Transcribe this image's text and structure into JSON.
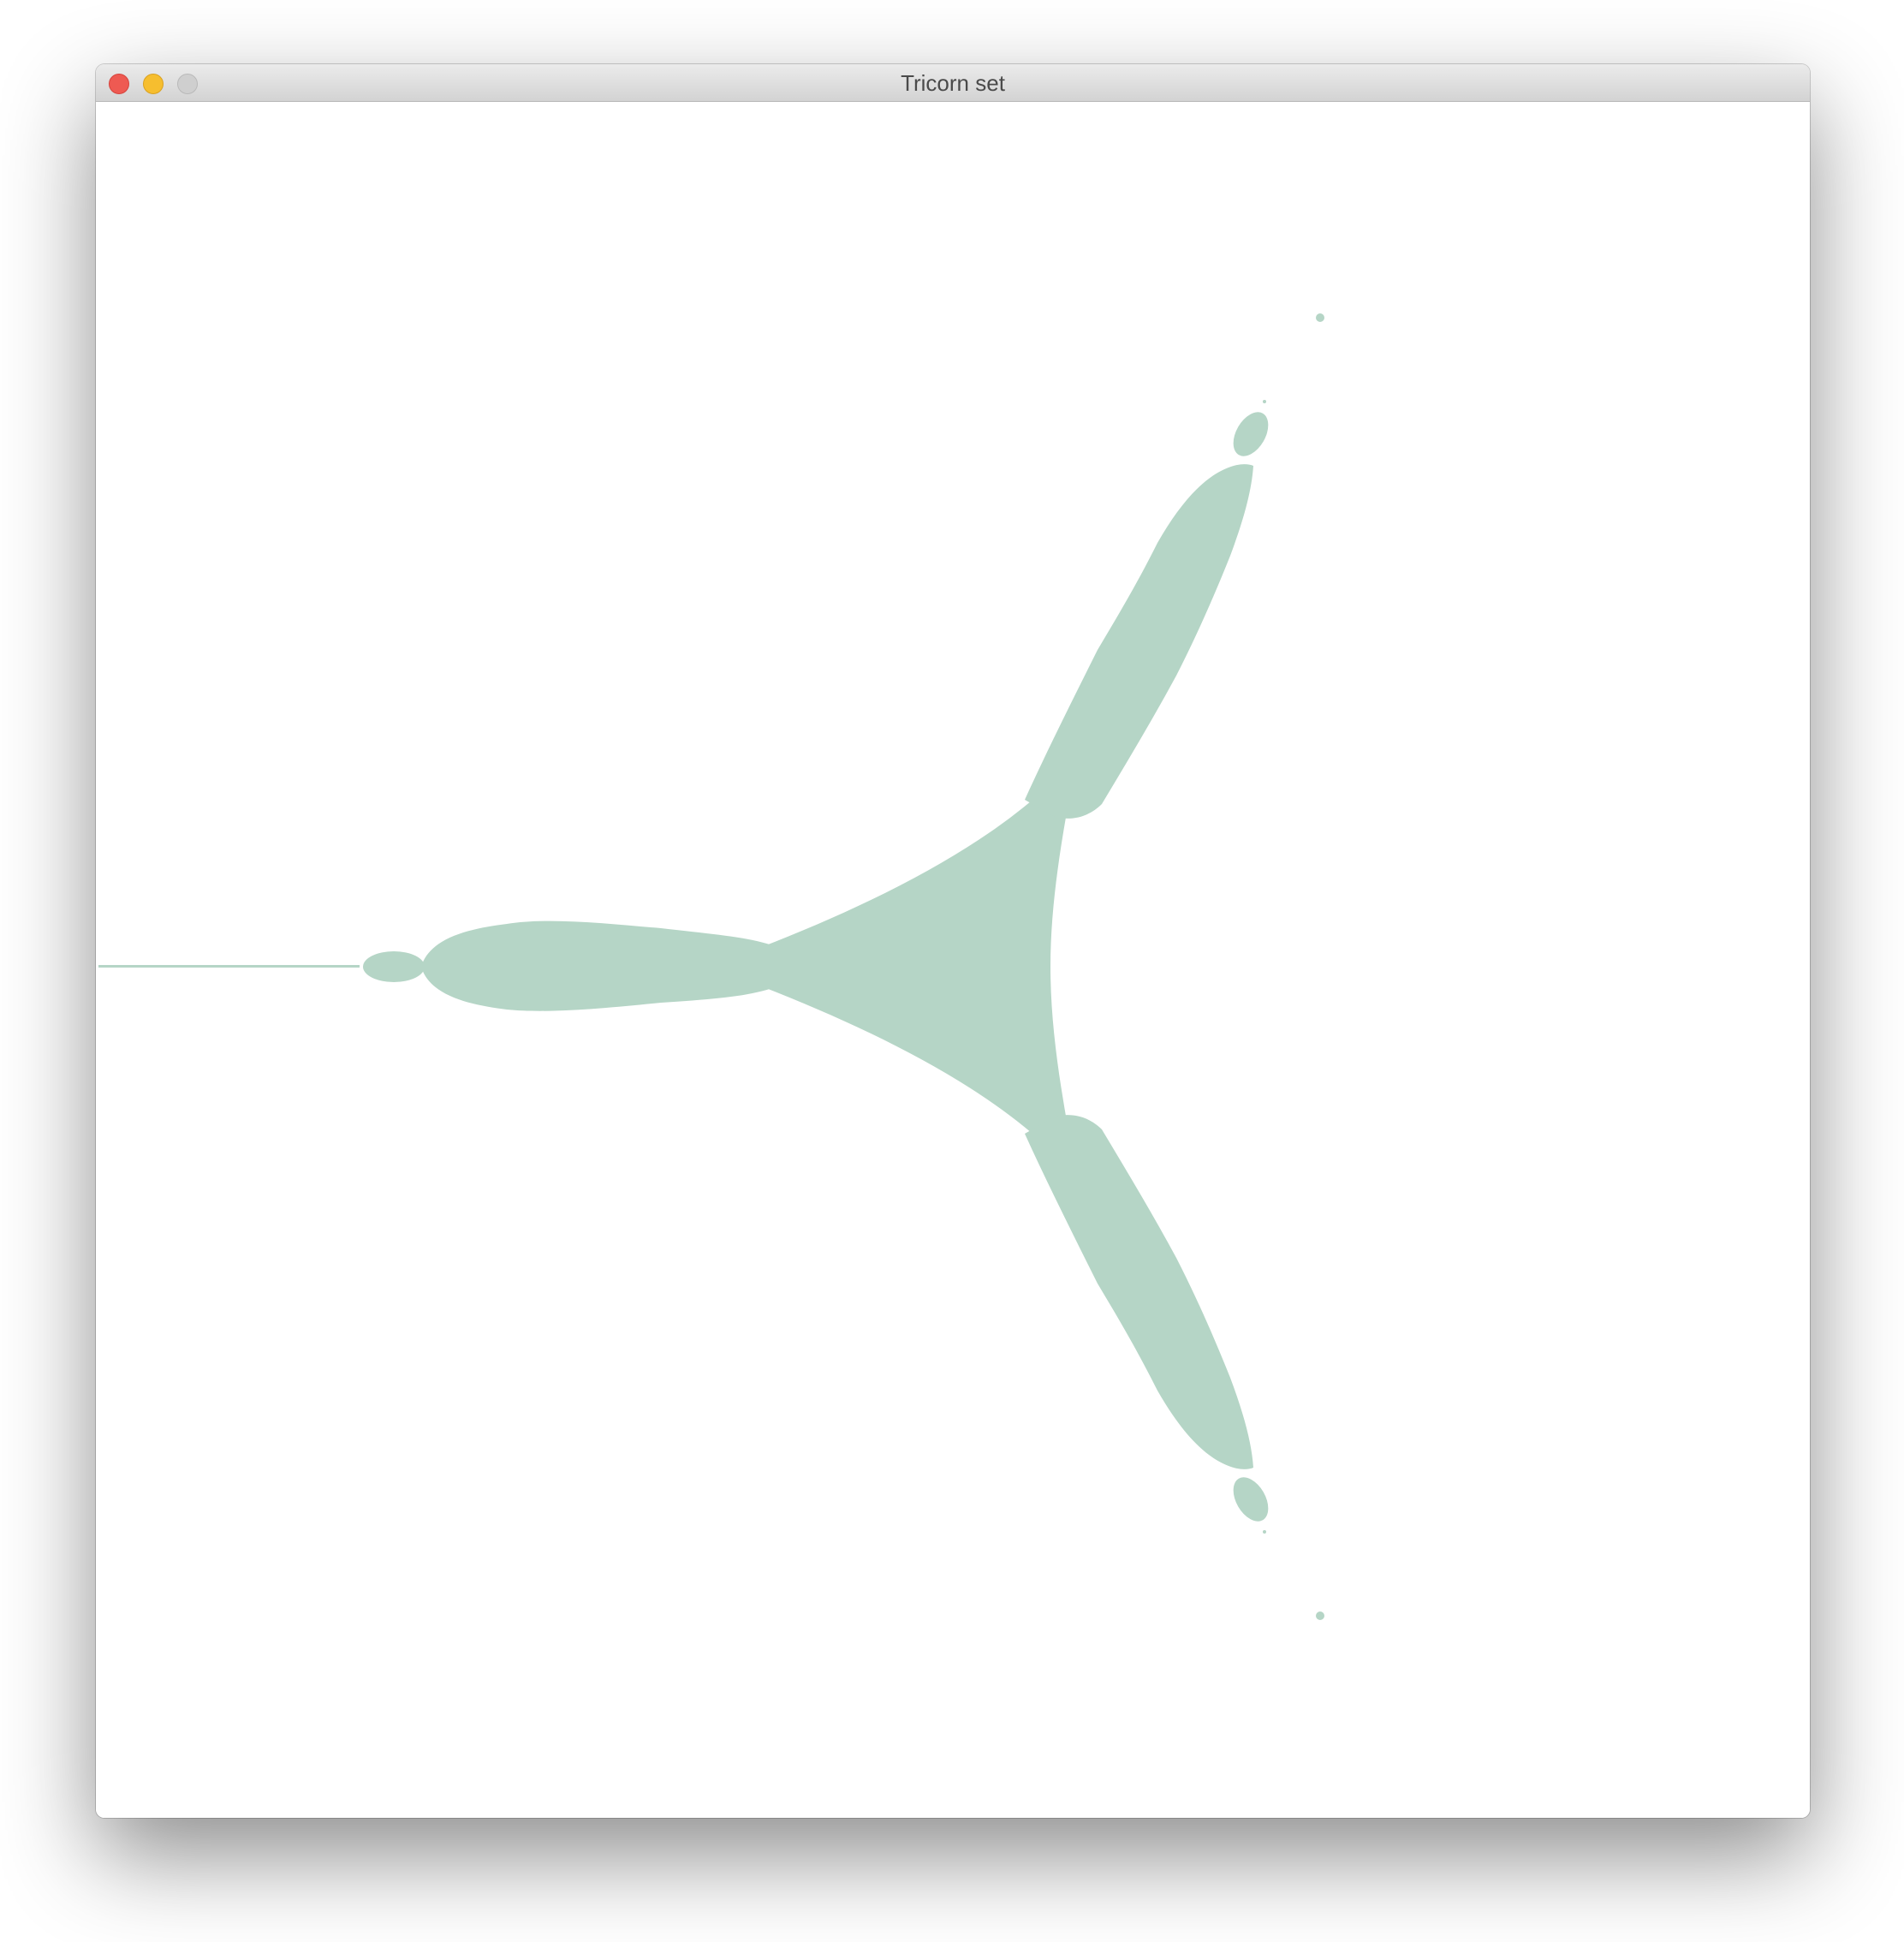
{
  "window": {
    "title": "Tricorn set",
    "buttons": {
      "close": "close-button",
      "minimize": "minimize-button",
      "zoom": "zoom-button"
    }
  },
  "canvas": {
    "background": "#ffffff",
    "fractal_color": "#b5d5c6",
    "fractal_name": "tricorn"
  },
  "colors": {
    "close": "#ee5a52",
    "minimize": "#f6be2f",
    "zoom_disabled": "#cfcfcf"
  }
}
